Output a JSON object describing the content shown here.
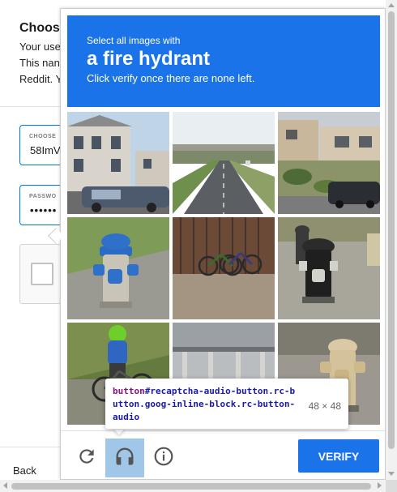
{
  "signup": {
    "title": "Choos",
    "desc_lines": [
      "Your use",
      "This nan",
      "Reddit. Y"
    ],
    "username_label": "CHOOSE",
    "username_value": "58ImV",
    "password_label": "PASSWO",
    "password_value": "••••••",
    "back_label": "Back"
  },
  "challenge": {
    "select_text": "Select all images with",
    "object": "a fire hydrant",
    "instruction": "Click verify once there are none left.",
    "tiles": [
      "house-with-parked-car-tile",
      "highway-tile",
      "hillside-houses-tile",
      "blue-fire-hydrant-tile",
      "bicycles-by-fence-tile",
      "black-fire-hydrant-tile",
      "child-on-bicycle-tile",
      "parking-garage-tile",
      "beige-fire-hydrant-tile"
    ],
    "verify_label": "VERIFY",
    "colors": {
      "accent": "#1a73e8",
      "audio_highlight": "#6fa8dc"
    }
  },
  "tooltip": {
    "tag": "button",
    "selector": "#recaptcha-audio-button.rc-button.goog-inline-block.rc-button-audio",
    "dims": "48 × 48"
  }
}
